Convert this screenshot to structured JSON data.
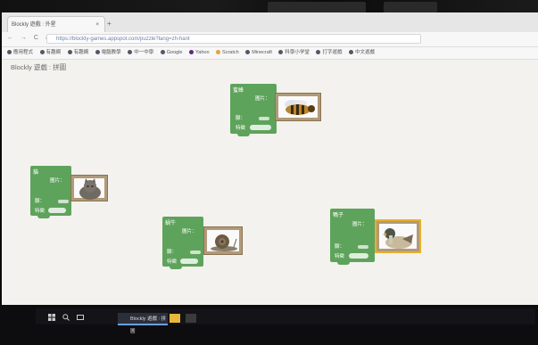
{
  "browser": {
    "tab_title": "Blockly 遊戲 : 外星",
    "tab_close": "×",
    "new_tab": "+",
    "nav": "← → C ⌂",
    "url": "https://blockly-games.appspot.com/puzzle?lang=zh-hant",
    "bookmarks": [
      "應用程式",
      "有趣網",
      "有趣網",
      "電腦教學",
      "中一中學",
      "Google",
      "Yahoo",
      "Scratch",
      "Minecraft",
      "科學小学堂",
      "打字遊戲",
      "中文遊戲"
    ]
  },
  "page": {
    "title": "Blockly 遊戲 : 拼圖"
  },
  "blocks": [
    {
      "name": "蜜蜂",
      "pic_label": "圖片：",
      "legs_label": "腳：",
      "legs_value": "",
      "feat_label": "特徵",
      "photo": "bee-photo"
    },
    {
      "name": "貓",
      "pic_label": "圖片：",
      "legs_label": "腳：",
      "legs_value": "",
      "feat_label": "特徵",
      "photo": "cat-photo"
    },
    {
      "name": "蝸牛",
      "pic_label": "圖片：",
      "legs_label": "腳：",
      "legs_value": "",
      "feat_label": "特徵",
      "photo": "snail-photo"
    },
    {
      "name": "鴨子",
      "pic_label": "圖片：",
      "legs_label": "腳：",
      "legs_value": "",
      "feat_label": "特徵",
      "photo": "duck-photo"
    }
  ],
  "taskbar": {
    "start_icon": "windows-icon",
    "search_icon": "search-icon",
    "app_label": "Blockly 遊戲 : 拼圖"
  },
  "colors": {
    "block_green": "#5ea35b",
    "workspace_bg": "#f3f2ee",
    "photo_frame": "#b09a78"
  }
}
